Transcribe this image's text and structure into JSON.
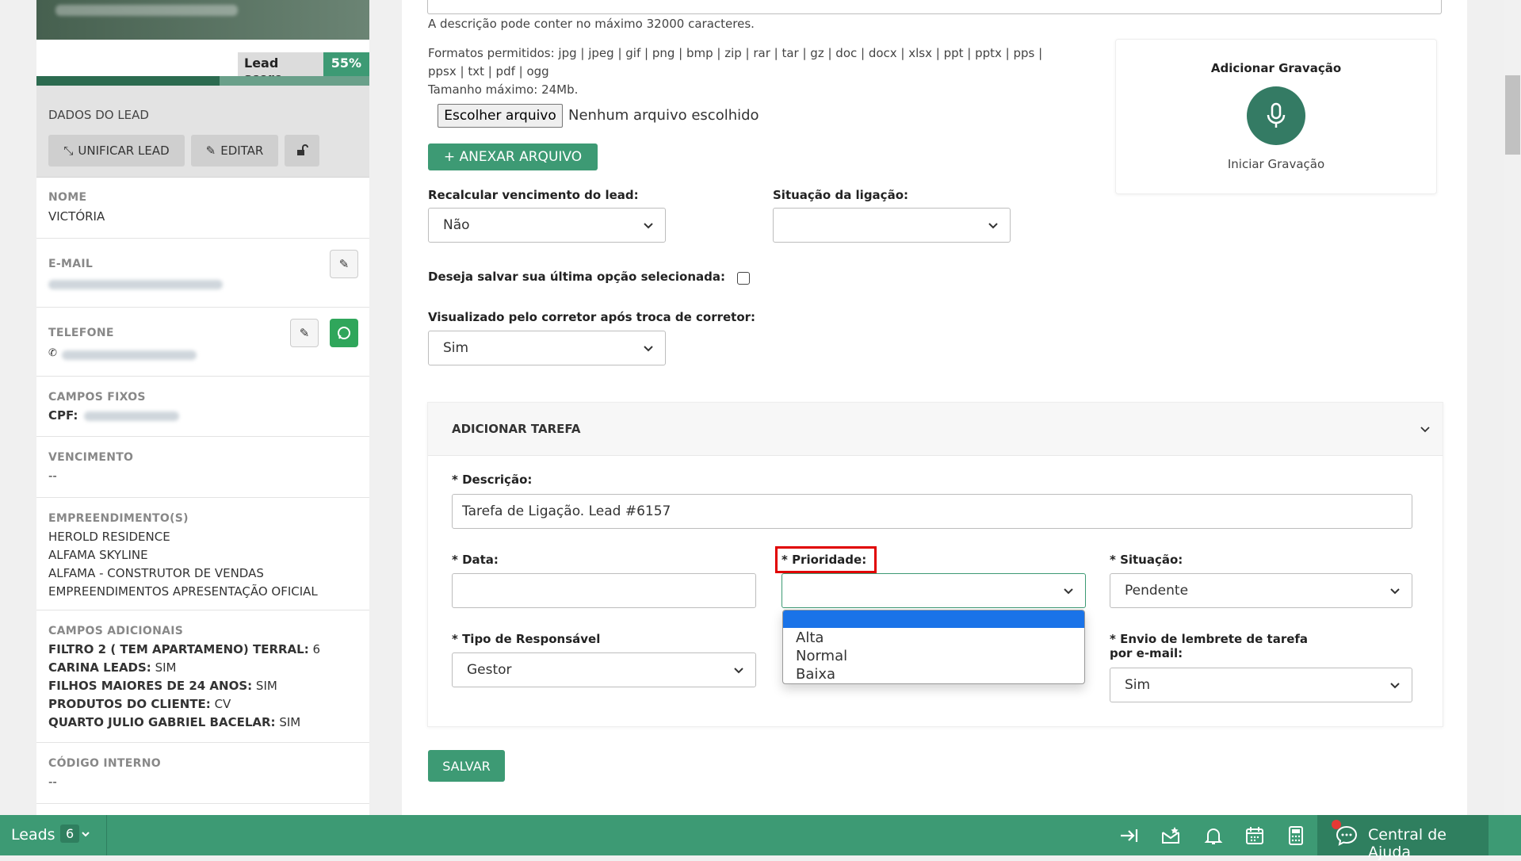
{
  "sidebar": {
    "lead_score_label": "Lead score",
    "lead_score_value": "55%",
    "lead_score_fraction": 0.55,
    "section_title": "DADOS DO LEAD",
    "buttons": {
      "unify": "UNIFICAR LEAD",
      "edit": "EDITAR"
    },
    "fields": {
      "nome_label": "NOME",
      "nome_value": "VICTÓRIA",
      "email_label": "E-MAIL",
      "telefone_label": "TELEFONE",
      "campos_fixos_label": "CAMPOS FIXOS",
      "cpf_label": "CPF:",
      "vencimento_label": "VENCIMENTO",
      "vencimento_value": "--",
      "empreendimentos_label": "EMPREENDIMENTO(S)",
      "empreendimentos": [
        "HEROLD RESIDENCE",
        "ALFAMA SKYLINE",
        "ALFAMA - CONSTRUTOR DE VENDAS",
        "EMPREENDIMENTOS APRESENTAÇÃO OFICIAL"
      ],
      "campos_adicionais_label": "CAMPOS ADICIONAIS",
      "campos_adicionais": [
        {
          "key": "FILTRO 2 ( TEM APARTAMENO) TERRAL:",
          "value": "6"
        },
        {
          "key": "CARINA LEADS:",
          "value": "SIM"
        },
        {
          "key": "FILHOS MAIORES DE 24 ANOS:",
          "value": "SIM"
        },
        {
          "key": "PRODUTOS DO CLIENTE:",
          "value": "CV"
        },
        {
          "key": "QUARTO JULIO GABRIEL BACELAR:",
          "value": "SIM"
        }
      ],
      "codigo_interno_label": "CÓDIGO INTERNO",
      "codigo_interno_value": "--"
    }
  },
  "main": {
    "desc_hint": "A descrição pode conter no máximo 32000 caracteres.",
    "formats_line1": "Formatos permitidos: jpg | jpeg | gif | png | bmp | zip | rar | tar | gz | doc | docx | xlsx | ppt | pptx | pps |",
    "formats_line2": "ppsx | txt | pdf | ogg",
    "max_size": "Tamanho máximo: 24Mb.",
    "choose_file_button": "Escolher arquivo",
    "no_file": "Nenhum arquivo escolhido",
    "attach_button": "+ ANEXAR ARQUIVO",
    "recalc_label": "Recalcular vencimento do lead:",
    "recalc_value": "Não",
    "call_status_label": "Situação da ligação:",
    "call_status_value": "",
    "save_last_label": "Deseja salvar sua última opção selecionada:",
    "viewed_label": "Visualizado pelo corretor após troca de corretor:",
    "viewed_value": "Sim",
    "recording": {
      "title": "Adicionar Gravação",
      "start": "Iniciar Gravação"
    },
    "task": {
      "header": "ADICIONAR TAREFA",
      "desc_label": "* Descrição:",
      "desc_value": "Tarefa de Ligação. Lead #6157",
      "date_label": "* Data:",
      "priority_label": "* Prioridade:",
      "priority_value": "",
      "priority_options": [
        "Alta",
        "Normal",
        "Baixa"
      ],
      "status_label": "* Situação:",
      "status_value": "Pendente",
      "resp_label": "* Tipo de Responsável",
      "resp_value": "Gestor",
      "reminder_label_1": "* Envio de lembrete de tarefa",
      "reminder_label_2": "por e-mail:",
      "reminder_value": "Sim"
    },
    "save_button": "SALVAR"
  },
  "bottombar": {
    "leads_label": "Leads",
    "leads_count": "6",
    "help_label": "Central de Ajuda"
  },
  "colors": {
    "accent": "#3d9a74",
    "highlight": "#e00000",
    "select_blue": "#1a73e8"
  }
}
